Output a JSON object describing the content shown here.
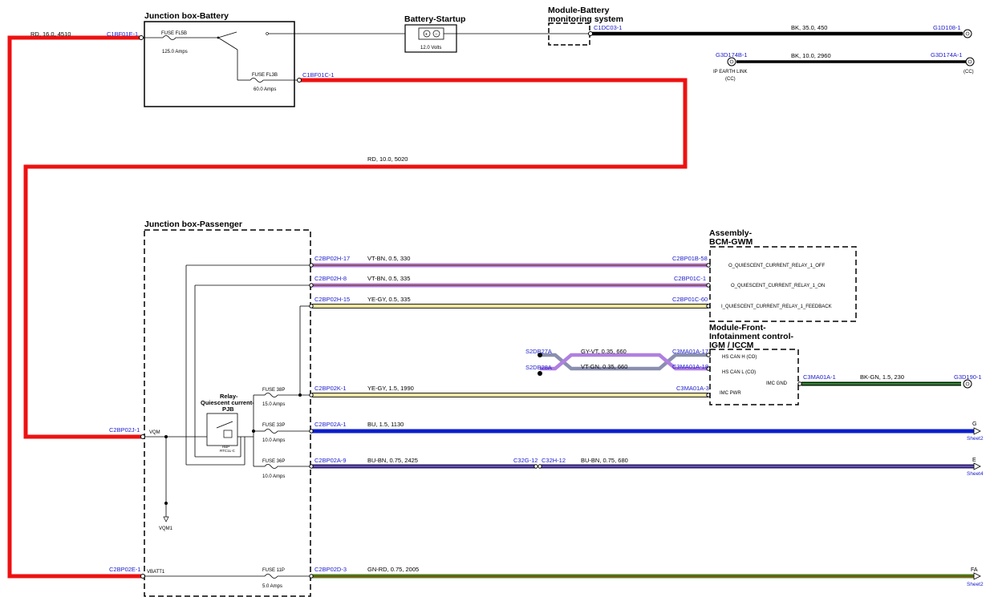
{
  "boxes": {
    "jb_battery": "Junction box-Battery",
    "battery_startup": "Battery-Startup",
    "module_battery_line1": "Module-Battery",
    "module_battery_line2": "monitoring system",
    "jb_passenger": "Junction box-Passenger",
    "bcm_line1": "Assembly-",
    "bcm_line2": "BCM-GWM",
    "iccm_line1": "Module-Front-",
    "iccm_line2": "Infotainment control-",
    "iccm_line3": "IGM / ICCM",
    "relay_line1": "Relay-",
    "relay_line2": "Quiescent current-",
    "relay_line3": "PJB",
    "relay_sub1": "RBP",
    "relay_sub2": "RTC1L-C"
  },
  "fuses": {
    "fl5b": {
      "name": "FUSE FL5B",
      "rating": "125.0 Amps"
    },
    "fl3b": {
      "name": "FUSE FL3B",
      "rating": "60.0 Amps"
    },
    "f38p": {
      "name": "FUSE 38P",
      "rating": "15.0 Amps"
    },
    "f33p": {
      "name": "FUSE 33P",
      "rating": "10.0 Amps"
    },
    "f36p": {
      "name": "FUSE 36P",
      "rating": "10.0 Amps"
    },
    "f11p": {
      "name": "FUSE 11P",
      "rating": "5.0 Amps"
    }
  },
  "battery": {
    "voltage": "12.0 Volts"
  },
  "connectors": {
    "c1bf01e": "C1BF01E-1",
    "c1bf01c": "C1BF01C-1",
    "c1dc03": "C1DC03-1",
    "g1d108": "G1D108-1",
    "g3d174b": "G3D174B-1",
    "g3d174a": "G3D174A-1",
    "c2bp02j": "C2BP02J-1",
    "c2bp02e": "C2BP02E-1",
    "c2bp02h17": "C2BP02H-17",
    "c2bp02h8": "C2BP02H-8",
    "c2bp02h15": "C2BP02H-15",
    "c2bp02k": "C2BP02K-1",
    "c2bp02a1": "C2BP02A-1",
    "c2bp02a9": "C2BP02A-9",
    "c2bp02d": "C2BP02D-3",
    "c2bp01b": "C2BP01B-58",
    "c2bp01c1": "C2BP01C-1",
    "c2bp01c60": "C2BP01C-60",
    "s2db27a": "S2DB27A",
    "s2db28a": "S2DB28A",
    "c3ma17": "C3MA01A-17",
    "c3ma18": "C3MA01A-18",
    "c3ma3": "C3MA01A-3",
    "c3ma1": "C3MA01A-1",
    "g3d190": "G3D190-1",
    "c32g": "C32G-12",
    "c32h": "C32H-12"
  },
  "wires": {
    "rd16": "RD,  16.0,  4510",
    "rd10": "RD,  10.0,  5020",
    "bk35": "BK,  35.0,  450",
    "bk10": "BK,  10.0,  2960",
    "vtbn330": "VT-BN,  0.5,  330",
    "vtbn335": "VT-BN,  0.5,  335",
    "yegy335": "YE-GY,  0.5,  335",
    "gyvt": "GY-VT,  0.35,  660",
    "vtgn": "VT-GN,  0.35,  660",
    "yegy1990": "YE-GY,  1.5,  1990",
    "bkgn": "BK-GN,  1.5,  230",
    "bu1130": "BU,  1.5,  1130",
    "bubn2425": "BU-BN,  0.75,  2425",
    "bubn680": "BU-BN,  0.75,  680",
    "gnrd": "GN-RD,  0.75,  2005"
  },
  "pins": {
    "q_off": "O_QUIESCENT_CURRENT_RELAY_1_OFF",
    "q_on": "O_QUIESCENT_CURRENT_RELAY_1_ON",
    "q_fb": "I_QUIESCENT_CURRENT_RELAY_1_FEEDBACK",
    "can_h": "HS CAN H (CO)",
    "can_l": "HS CAN L (CO)",
    "imc_gnd": "IMC GND",
    "imc_pwr": "IMC PWR",
    "vqm": "VQM",
    "vqm1": "VQM1",
    "vbatt": "VBATT1"
  },
  "ground": {
    "ip_earth": "IP EARTH LINK",
    "cc_left": "(CC)",
    "cc_right": "(CC)"
  },
  "offpage": {
    "g": {
      "letter": "G",
      "sheet": "Sheet2"
    },
    "e": {
      "letter": "E",
      "sheet": "Sheet4"
    },
    "fa": {
      "letter": "FA",
      "sheet": "Sheet2"
    }
  },
  "colors": {
    "red": "#ee1111",
    "black": "#000000",
    "violet": "#b07fe0",
    "brown": "#7a3b2e",
    "yellow": "#ece3a0",
    "grey": "#8a8fb0",
    "blue": "#0a1ecc",
    "green": "#1f9a1f",
    "link": "#1a1acc"
  }
}
